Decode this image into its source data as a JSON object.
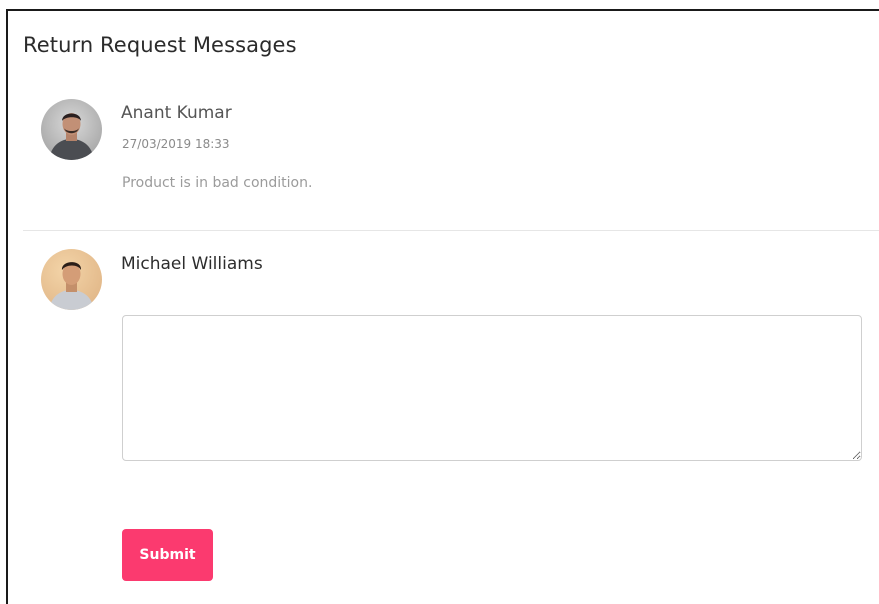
{
  "page": {
    "title": "Return Request Messages"
  },
  "messages": [
    {
      "author": "Anant Kumar",
      "date": "27/03/2019 18:33",
      "body": "Product is in bad condition.",
      "avatar_icon": "user-avatar-photo"
    }
  ],
  "reply": {
    "author": "Michael Williams",
    "avatar_icon": "user-avatar-photo",
    "textarea_value": "",
    "textarea_placeholder": "",
    "submit_label": "Submit"
  },
  "colors": {
    "accent": "#fb3a6f",
    "divider": "#e6e6e6",
    "border": "#cfcfcf"
  }
}
